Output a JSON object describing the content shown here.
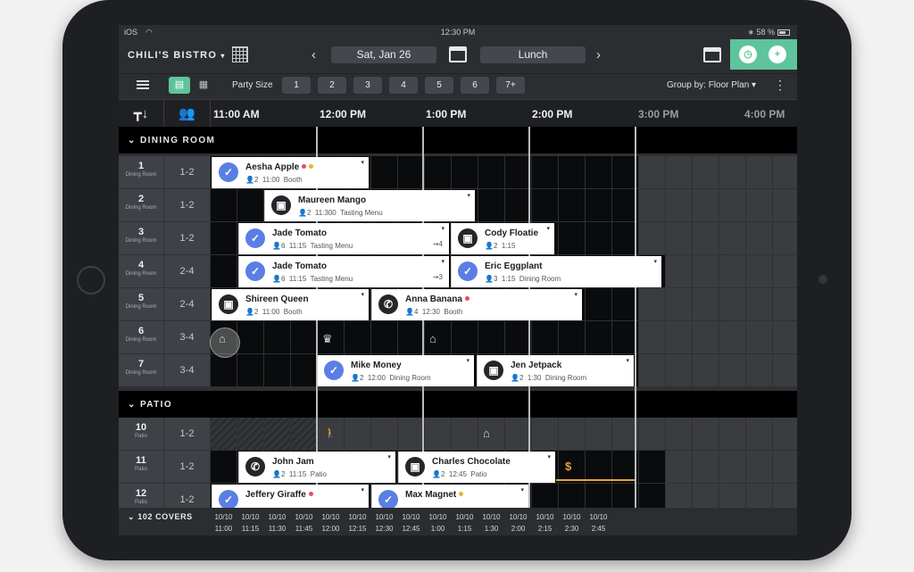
{
  "status": {
    "left": "iOS",
    "time": "12:30 PM",
    "battery": "58 %"
  },
  "topbar": {
    "venue": "CHILI'S BISTRO",
    "venue_caret": "▾",
    "prev": "‹",
    "next": "›",
    "date": "Sat, Jan 26",
    "shift": "Lunch"
  },
  "filters": {
    "party_label": "Party Size",
    "sizes": [
      "1",
      "2",
      "3",
      "4",
      "5",
      "6",
      "7+"
    ],
    "group_by": "Group by: Floor Plan ▾",
    "more": "⋮"
  },
  "times": [
    "11:00 AM",
    "12:00 PM",
    "1:00 PM",
    "2:00 PM",
    "3:00 PM",
    "4:00 PM"
  ],
  "sections": {
    "dining": "DINING ROOM",
    "patio": "PATIO"
  },
  "rows": [
    {
      "num": "1",
      "area": "Dining Room",
      "party": "1-2"
    },
    {
      "num": "2",
      "area": "Dining Room",
      "party": "1-2"
    },
    {
      "num": "3",
      "area": "Dining Room",
      "party": "1-2"
    },
    {
      "num": "4",
      "area": "Dining Room",
      "party": "2-4"
    },
    {
      "num": "5",
      "area": "Dining Room",
      "party": "2-4"
    },
    {
      "num": "6",
      "area": "Dining Room",
      "party": "3-4"
    },
    {
      "num": "7",
      "area": "Dining Room",
      "party": "3-4"
    },
    {
      "num": "10",
      "area": "Patio",
      "party": "1-2"
    },
    {
      "num": "11",
      "area": "Patio",
      "party": "1-2"
    },
    {
      "num": "12",
      "area": "Patio",
      "party": "1-2"
    }
  ],
  "reservations": [
    {
      "name": "Aesha Apple",
      "party": "2",
      "time": "11:00",
      "note": "Booth",
      "icon": "check",
      "status": "✓"
    },
    {
      "name": "Maureen Mango",
      "party": "2",
      "time": "11:300",
      "note": "Tasting Menu",
      "icon": "book",
      "status": "▣"
    },
    {
      "name": "Jade Tomato",
      "party": "6",
      "time": "11:15",
      "note": "Tasting Menu",
      "icon": "check",
      "status": "✓",
      "mark": "⇝4"
    },
    {
      "name": "Cody Floatie",
      "party": "2",
      "time": "1:15",
      "note": "",
      "icon": "book",
      "status": "▣"
    },
    {
      "name": "Jade Tomato",
      "party": "6",
      "time": "11:15",
      "note": "Tasting Menu",
      "icon": "check",
      "status": "✓",
      "mark": "⇝3"
    },
    {
      "name": "Eric Eggplant",
      "party": "3",
      "time": "1:15",
      "note": "Dining Room",
      "icon": "check",
      "status": "✓"
    },
    {
      "name": "Shireen Queen",
      "party": "2",
      "time": "11:00",
      "note": "Booth",
      "icon": "book",
      "status": "▣"
    },
    {
      "name": "Anna Banana",
      "party": "4",
      "time": "12:30",
      "note": "Booth",
      "icon": "phone",
      "status": "✆"
    },
    {
      "name": "Mike Money",
      "party": "2",
      "time": "12:00",
      "note": "Dining Room",
      "icon": "check",
      "status": "✓"
    },
    {
      "name": "Jen Jetpack",
      "party": "2",
      "time": "1:30",
      "note": "Dining Room",
      "icon": "book",
      "status": "▣"
    },
    {
      "name": "John Jam",
      "party": "2",
      "time": "11:15",
      "note": "Patio",
      "icon": "phone",
      "status": "✆"
    },
    {
      "name": "Charles Chocolate",
      "party": "2",
      "time": "12:45",
      "note": "Patio",
      "icon": "book",
      "status": "▣"
    },
    {
      "name": "Jeffery Giraffe",
      "party": "",
      "time": "",
      "note": "",
      "icon": "check",
      "status": "✓"
    },
    {
      "name": "Max Magnet",
      "party": "",
      "time": "",
      "note": "",
      "icon": "check",
      "status": "✓"
    }
  ],
  "glyphs": {
    "home": "⌂",
    "crown": "♛",
    "walk": "🚶",
    "dollar": "$"
  },
  "footer": {
    "covers": "102 COVERS",
    "slots": [
      {
        "c": "10/10",
        "t": "11:00"
      },
      {
        "c": "10/10",
        "t": "11:15"
      },
      {
        "c": "10/10",
        "t": "11:30"
      },
      {
        "c": "10/10",
        "t": "11:45"
      },
      {
        "c": "10/10",
        "t": "12:00"
      },
      {
        "c": "10/10",
        "t": "12:15"
      },
      {
        "c": "10/10",
        "t": "12:30"
      },
      {
        "c": "10/10",
        "t": "12:45"
      },
      {
        "c": "10/10",
        "t": "1:00"
      },
      {
        "c": "10/10",
        "t": "1:15"
      },
      {
        "c": "10/10",
        "t": "1:30"
      },
      {
        "c": "10/10",
        "t": "2:00"
      },
      {
        "c": "10/10",
        "t": "2:15"
      },
      {
        "c": "10/10",
        "t": "2:30"
      },
      {
        "c": "10/10",
        "t": "2:45"
      }
    ]
  },
  "colors": {
    "accent_green": "#5ec49c",
    "confirmed_blue": "#5b7ee5",
    "dot_red": "#e84a5f",
    "dot_yellow": "#e2b33b",
    "dollar": "#e2a33b"
  }
}
